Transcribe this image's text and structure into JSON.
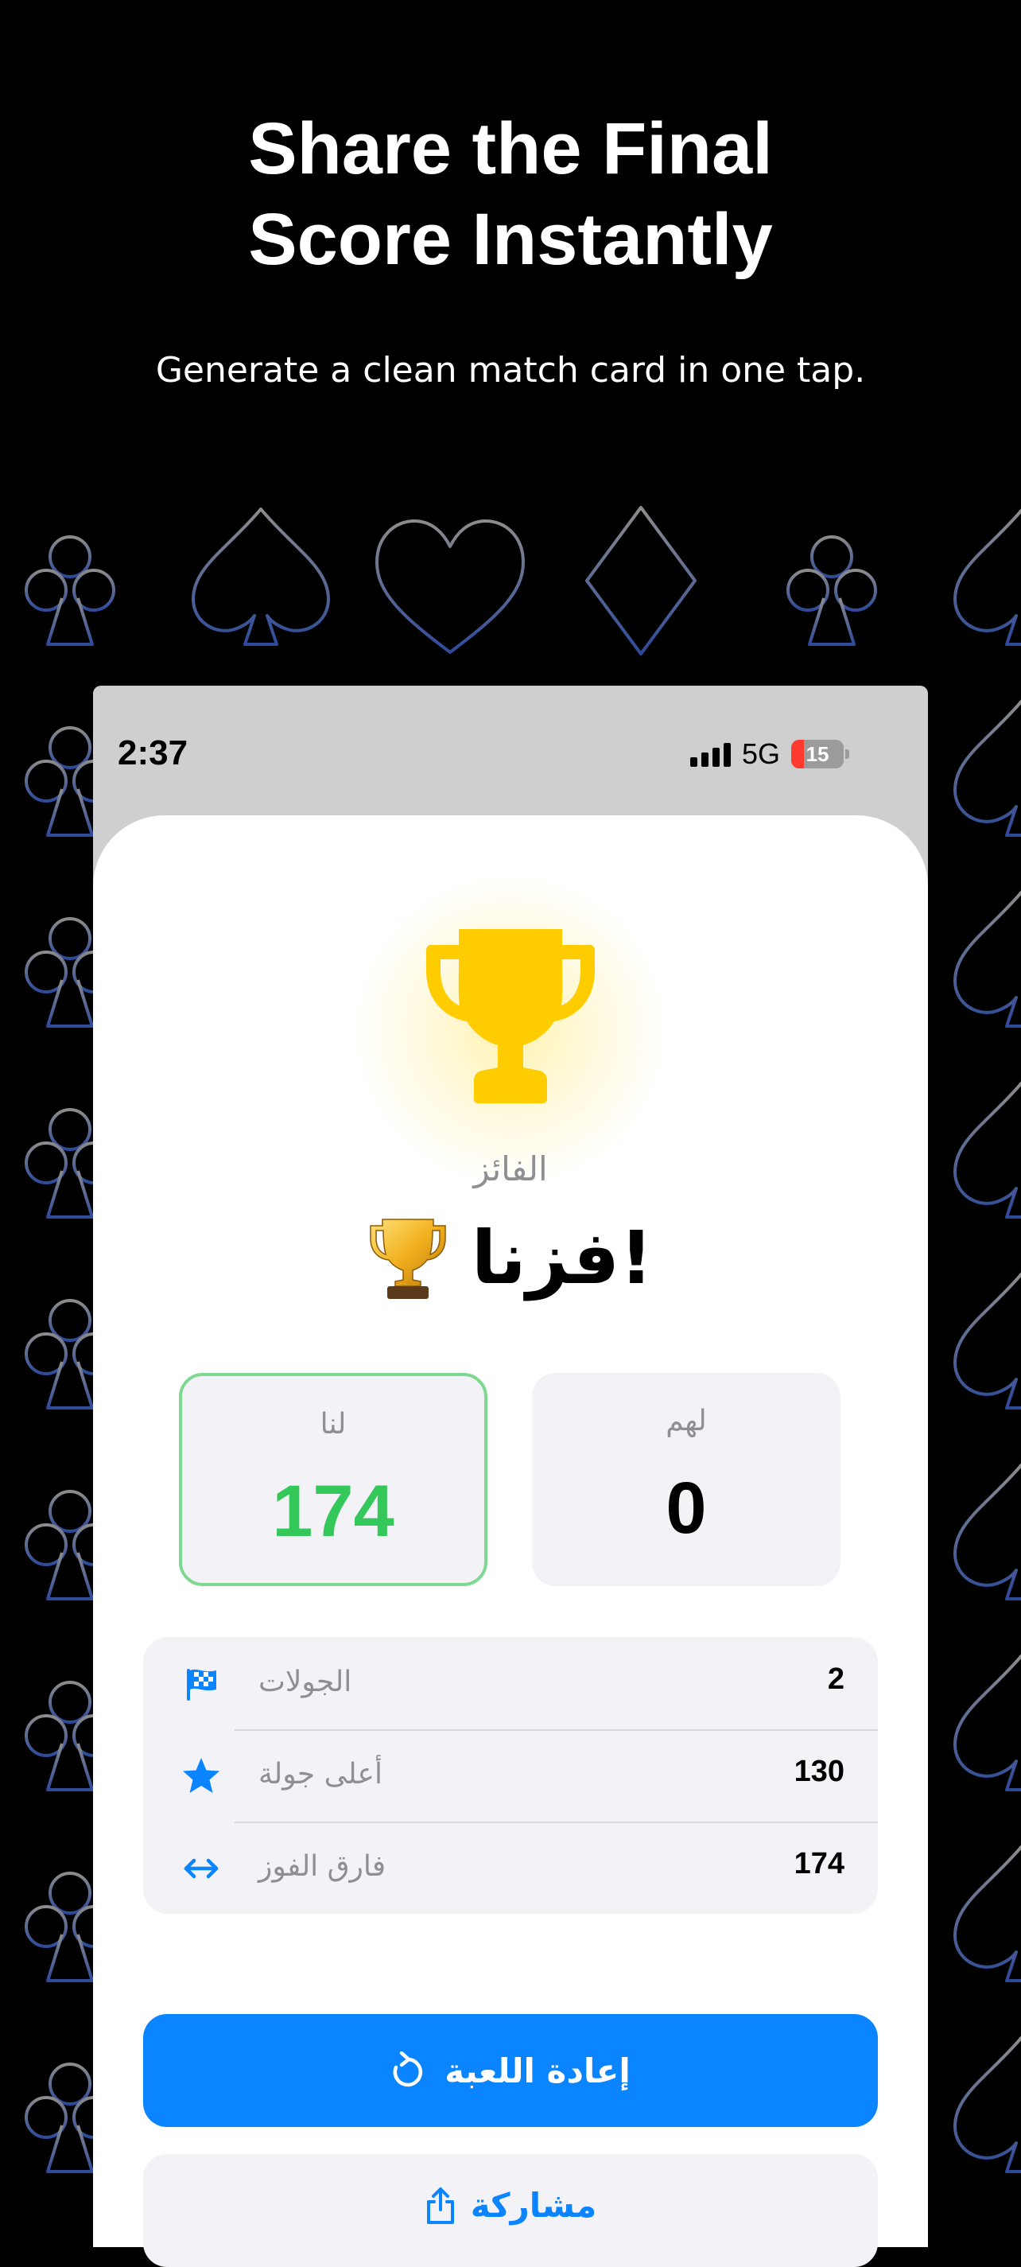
{
  "promo": {
    "headline_line1": "Share the Final",
    "headline_line2": "Score Instantly",
    "subtitle": "Generate a clean match card in one tap."
  },
  "status_bar": {
    "time": "2:37",
    "network": "5G",
    "battery": "15"
  },
  "result": {
    "winner_label": "الفائز",
    "winner_title": "فزنا!"
  },
  "scores": {
    "ours": {
      "label": "لنا",
      "value": "174"
    },
    "theirs": {
      "label": "لهم",
      "value": "0"
    }
  },
  "stats": [
    {
      "label": "الجولات",
      "value": "2",
      "icon": "checkered-flag-icon"
    },
    {
      "label": "أعلى جولة",
      "value": "130",
      "icon": "star-icon"
    },
    {
      "label": "فارق الفوز",
      "value": "174",
      "icon": "left-right-arrow-icon"
    }
  ],
  "buttons": {
    "replay": "إعادة اللعبة",
    "share": "مشاركة"
  },
  "colors": {
    "accent": "#0a84ff",
    "win_green": "#34c759",
    "trophy_gold": "#ffcc00"
  }
}
